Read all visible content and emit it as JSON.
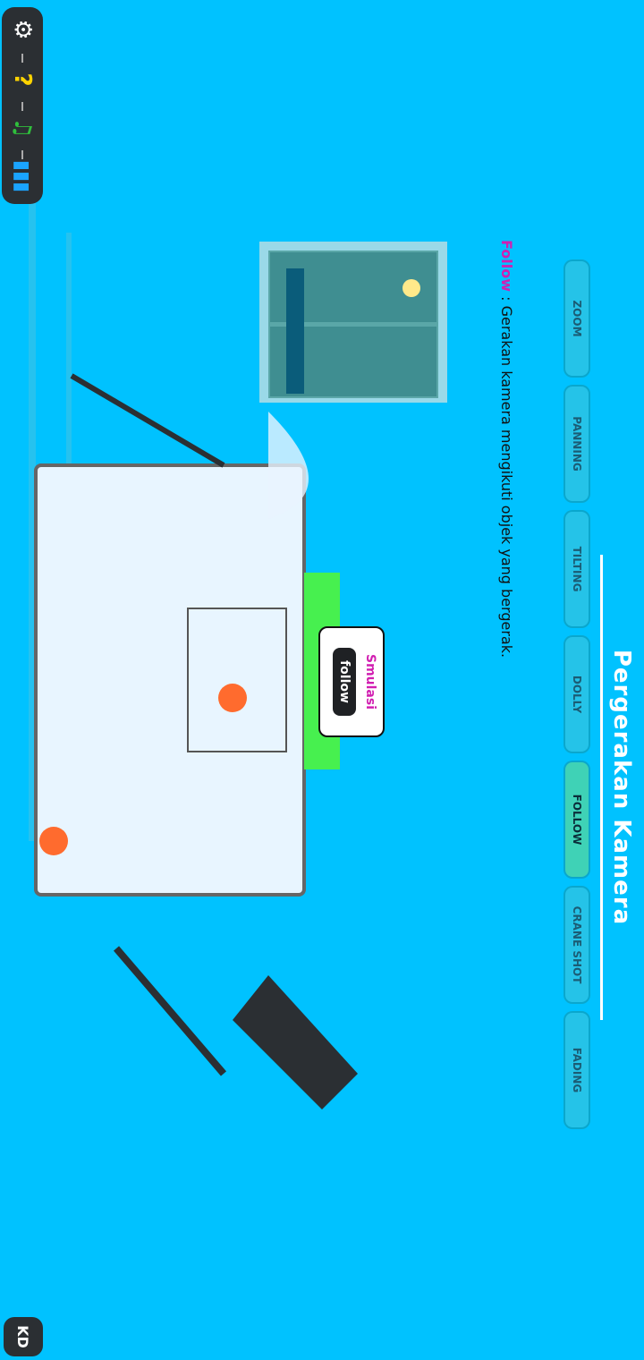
{
  "badge": "KD",
  "title": "Pergerakan Kamera",
  "tabs": [
    "ZOOM",
    "PANNING",
    "TILTING",
    "DOLLY",
    "FOLLOW",
    "CRANE SHOT",
    "FADING"
  ],
  "active_tab": "FOLLOW",
  "description": {
    "keyword": "Follow",
    "text": " : Gerakan  kamera mengikuti objek yang bergerak."
  },
  "simulasi": {
    "label": "Smulasi",
    "tag": "follow"
  },
  "toolbar": {
    "settings": "settings-icon",
    "help": "?",
    "music": "music-icon",
    "volume": "volume-icon"
  }
}
